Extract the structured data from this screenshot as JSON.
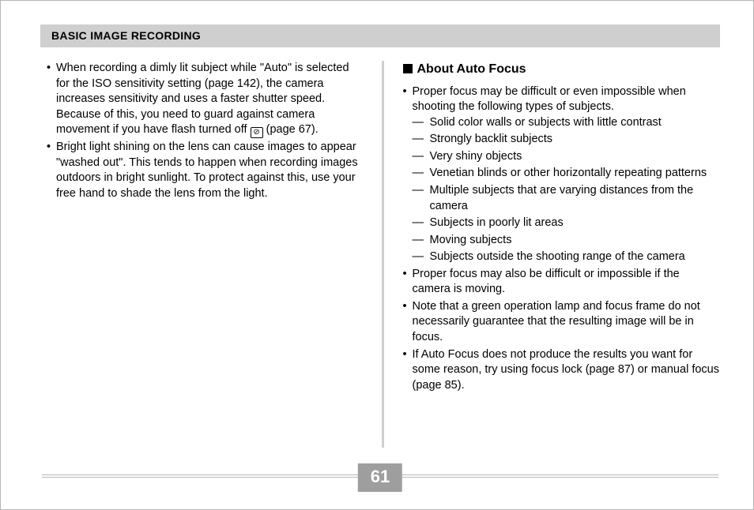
{
  "header": {
    "title": "BASIC IMAGE RECORDING"
  },
  "left": {
    "bullets": [
      {
        "pre": "When recording a dimly lit subject while \"Auto\" is selected for the ISO sensitivity setting (page 142), the camera increases sensitivity and uses a faster shutter speed. Because of this, you need to guard against camera movement if you have flash turned off ",
        "icon": "flash-off",
        "post": " (page 67)."
      },
      {
        "text": "Bright light shining on the lens can cause images to appear \"washed out\". This tends to happen when recording images outdoors in bright sunlight. To protect against this, use your free hand to shade the lens from the light."
      }
    ]
  },
  "right": {
    "heading": "About Auto Focus",
    "bullets": [
      {
        "text": "Proper focus may be difficult or even impossible when shooting the following types of subjects.",
        "sub": [
          "Solid color walls or subjects with little contrast",
          "Strongly backlit subjects",
          "Very shiny objects",
          "Venetian blinds or other horizontally repeating patterns",
          "Multiple subjects that are varying distances from the camera",
          "Subjects in poorly lit areas",
          "Moving subjects",
          "Subjects outside the shooting range of the camera"
        ]
      },
      {
        "text": "Proper focus may also be difficult or impossible if the camera is moving."
      },
      {
        "text": "Note that a green operation lamp and focus frame do not necessarily guarantee that the resulting image will be in focus."
      },
      {
        "text": "If Auto Focus does not produce the results you want for some reason, try using focus lock (page 87) or manual focus (page 85)."
      }
    ]
  },
  "footer": {
    "page": "61"
  },
  "icons": {
    "flash_off_glyph": "⊘"
  }
}
